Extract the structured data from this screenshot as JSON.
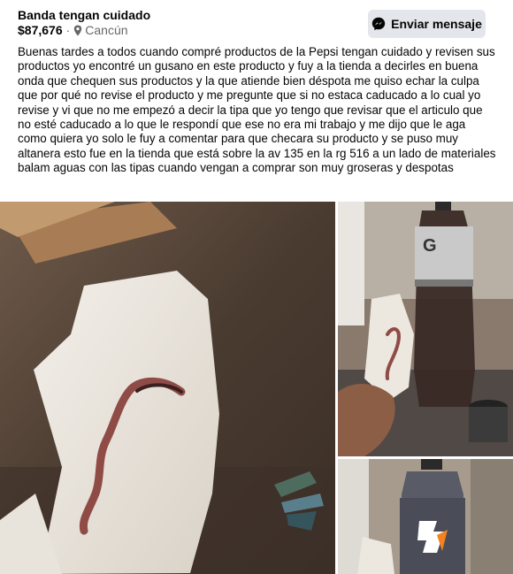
{
  "post": {
    "title": "Banda tengan cuidado",
    "price": "$87,676",
    "separator": "·",
    "location": "Cancún",
    "location_icon": "map-pin-icon",
    "message_button": {
      "label": "Enviar mensaje",
      "icon": "messenger-icon"
    },
    "body": "Buenas tardes a todos cuando compré productos de la Pepsi tengan cuidado y revisen sus productos yo encontré un gusano en este producto y fuy a la tienda a decirles en buena onda que chequen sus productos y la que atiende bien déspota me quiso echar la culpa que por qué no revise el producto y me pregunte que si no estaca caducado a lo cual yo revise y vi que no me empezó a decir la tipa que yo tengo que revisar que el articulo que no esté caducado a lo que le respondí que ese no era mi trabajo y me dijo que le aga como quiera yo solo le fuy a comentar para que checara su producto y se puso muy altanera esto fue en la tienda que está sobre la av 135 en la rg 516 a un lado de materiales balam aguas con las tipas cuando vengan a comprar son muy groseras y despotas"
  },
  "photos": [
    {
      "name": "photo-worm-closeup",
      "subject": "worm on tissue paper"
    },
    {
      "name": "photo-bottle-with-worm",
      "subject": "Gatorade bottle and worm on tissue"
    },
    {
      "name": "photo-bottle-logo",
      "subject": "Gatorade bottle G logo"
    }
  ],
  "colors": {
    "text": "#050505",
    "secondary_text": "#65676b",
    "button_bg": "#e4e6eb"
  }
}
